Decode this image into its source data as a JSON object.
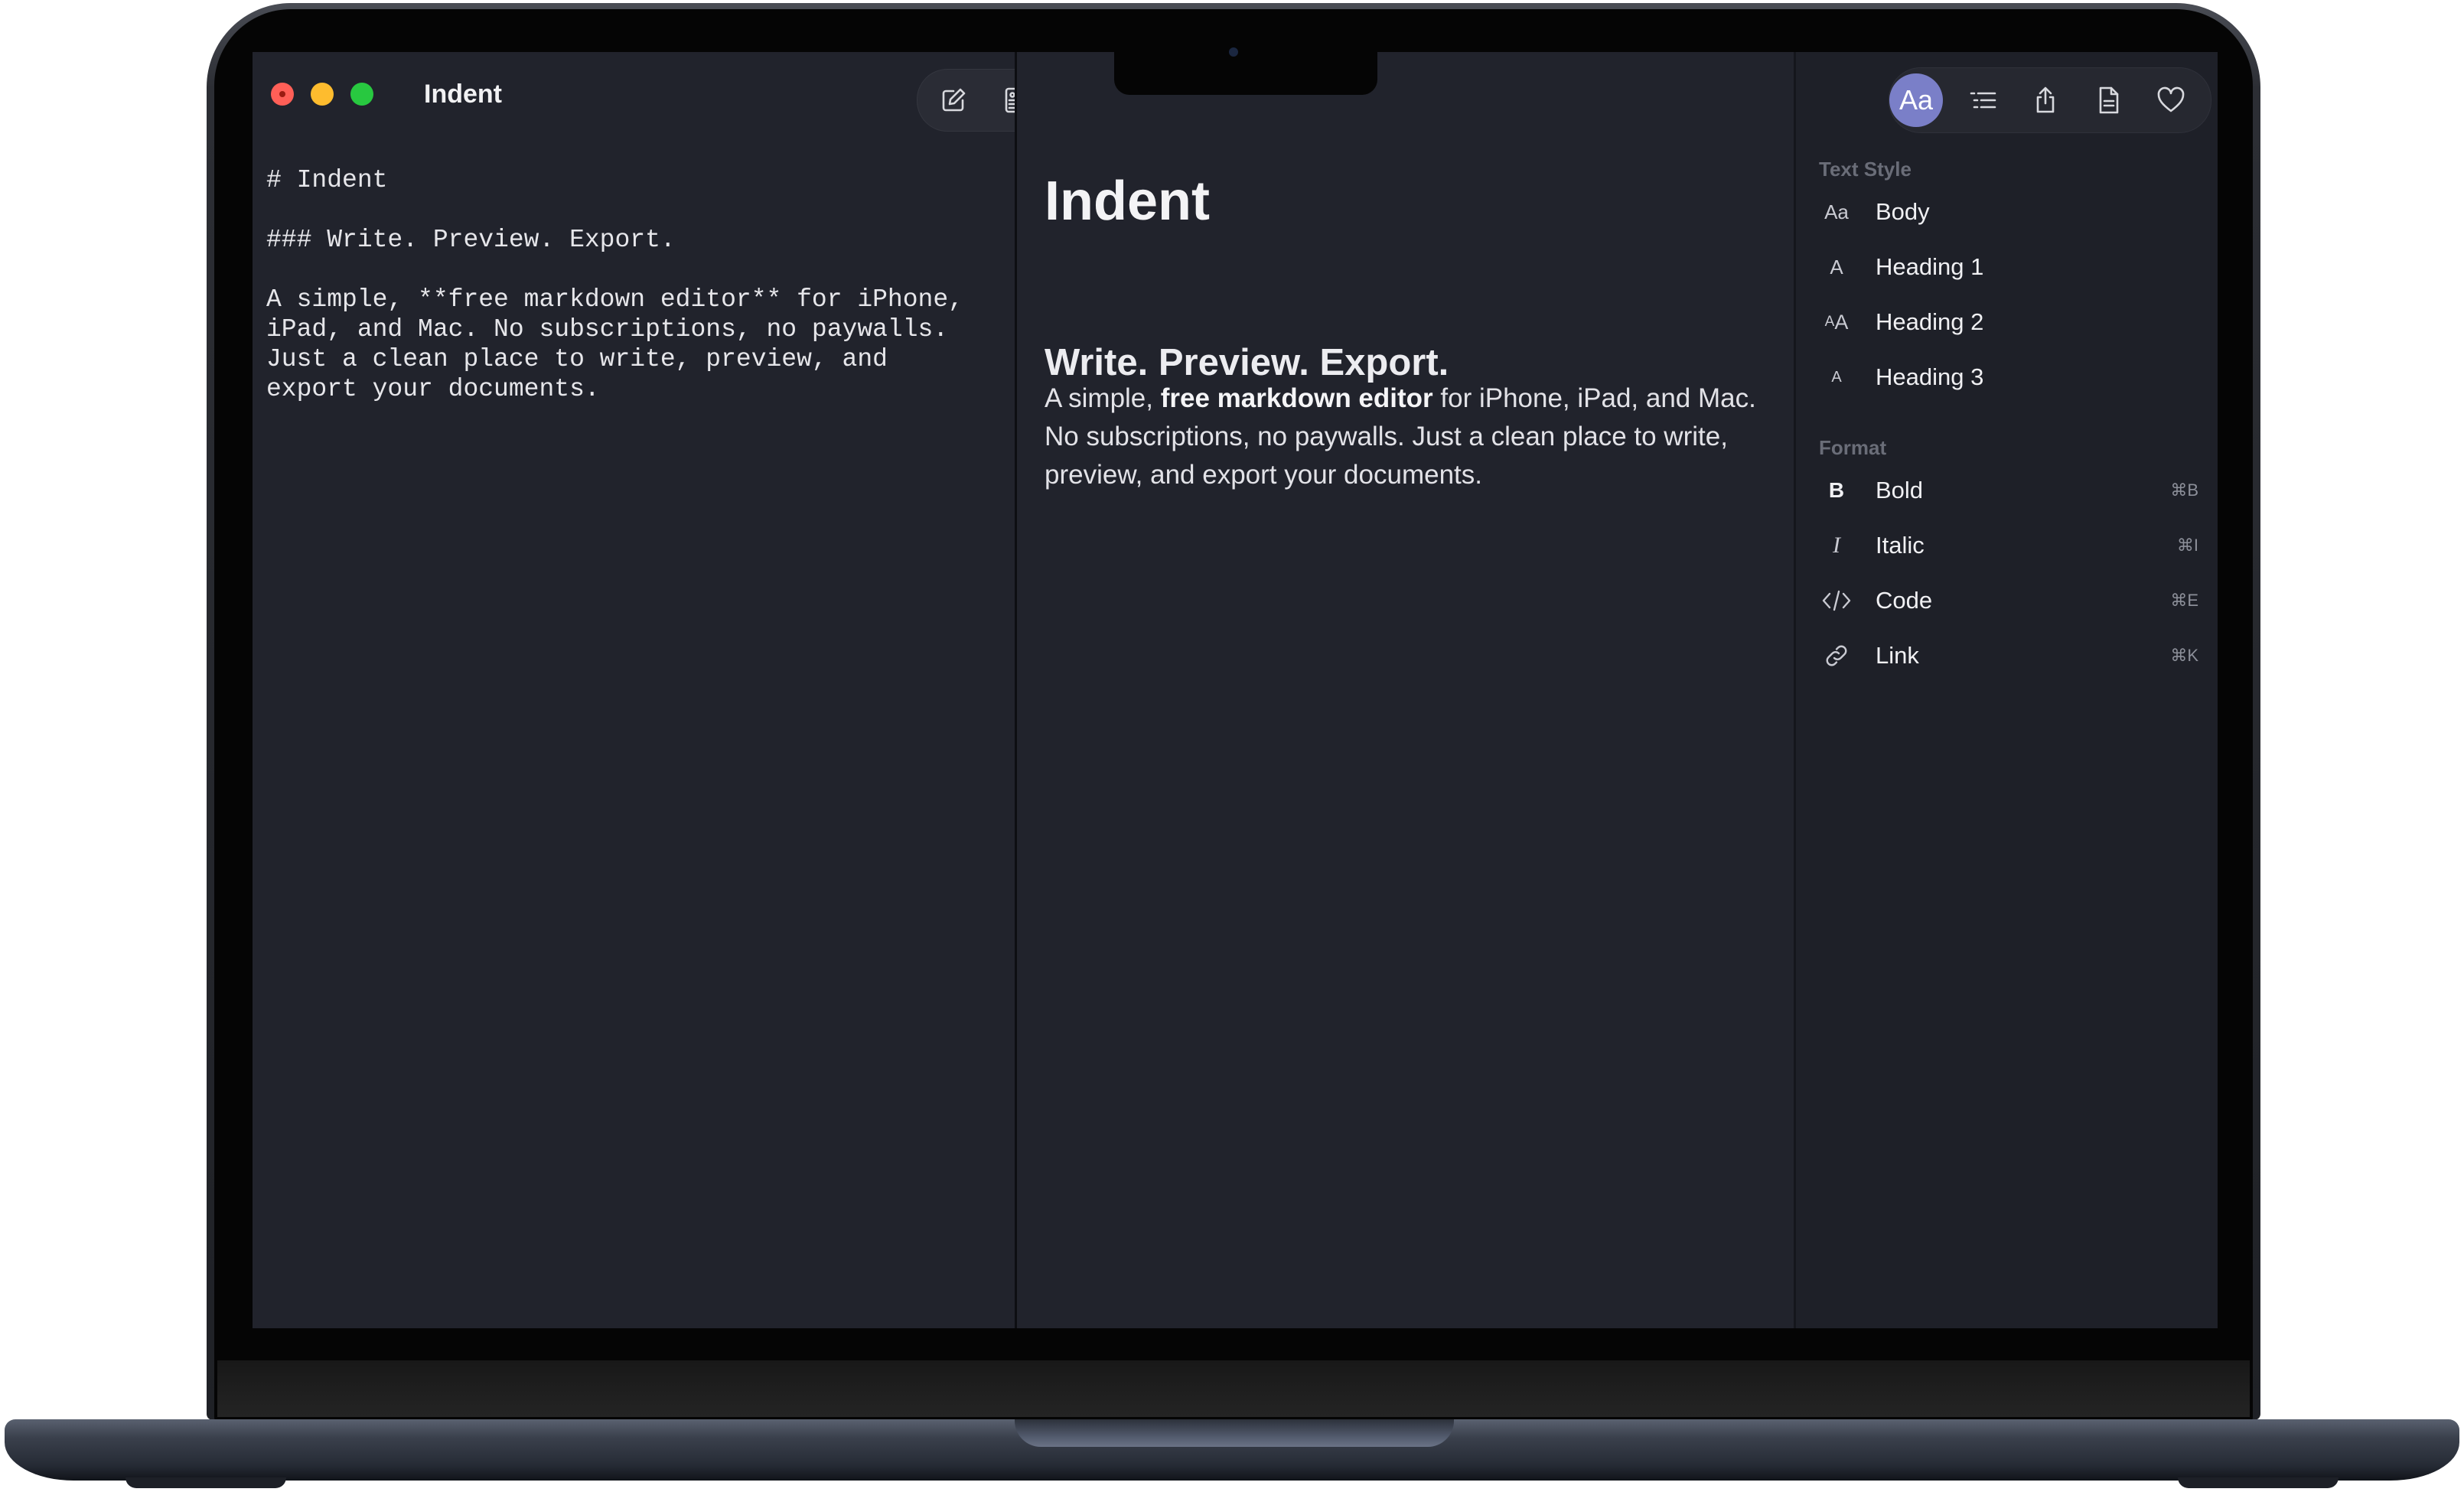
{
  "window": {
    "title": "Indent"
  },
  "toolbar": {
    "buttons": [
      {
        "icon": "compose-icon"
      },
      {
        "icon": "preview-document-icon"
      },
      {
        "icon": "split-view-icon",
        "active": true
      }
    ]
  },
  "editor": {
    "lines": [
      "# Indent",
      "",
      "### Write. Preview. Export.",
      "",
      "A simple, **free markdown editor** for iPhone,",
      "iPad, and Mac. No subscriptions, no paywalls.",
      "Just a clean place to write, preview, and",
      "export your documents."
    ]
  },
  "preview": {
    "h1": "Indent",
    "h3": "Write. Preview. Export.",
    "para_before": "A simple, ",
    "para_bold": "free markdown editor",
    "para_after": " for iPhone, iPad, and Mac. No subscriptions, no paywalls. Just a clean place to write, preview, and export your documents."
  },
  "inspector": {
    "toolbar": {
      "text_style_button": "Aa",
      "icons": [
        "outline-list-icon",
        "share-icon",
        "document-icon",
        "heart-icon"
      ]
    },
    "text_style": {
      "label": "Text Style",
      "items": [
        {
          "icon": "Aa",
          "label": "Body"
        },
        {
          "icon": "A",
          "label": "Heading 1"
        },
        {
          "icon": "AA",
          "label": "Heading 2"
        },
        {
          "icon": "A",
          "label": "Heading 3"
        }
      ]
    },
    "format": {
      "label": "Format",
      "items": [
        {
          "icon": "B",
          "label": "Bold",
          "shortcut": "⌘B"
        },
        {
          "icon": "I",
          "label": "Italic",
          "shortcut": "⌘I"
        },
        {
          "icon": "code-icon",
          "label": "Code",
          "shortcut": "⌘E"
        },
        {
          "icon": "link-icon",
          "label": "Link",
          "shortcut": "⌘K"
        }
      ]
    }
  },
  "colors": {
    "background": "#21232c",
    "inspector_background": "#1e2028",
    "accent": "#7a7fc8",
    "traffic_red": "#ff5f57",
    "traffic_yellow": "#febc2e",
    "traffic_green": "#28c840"
  }
}
